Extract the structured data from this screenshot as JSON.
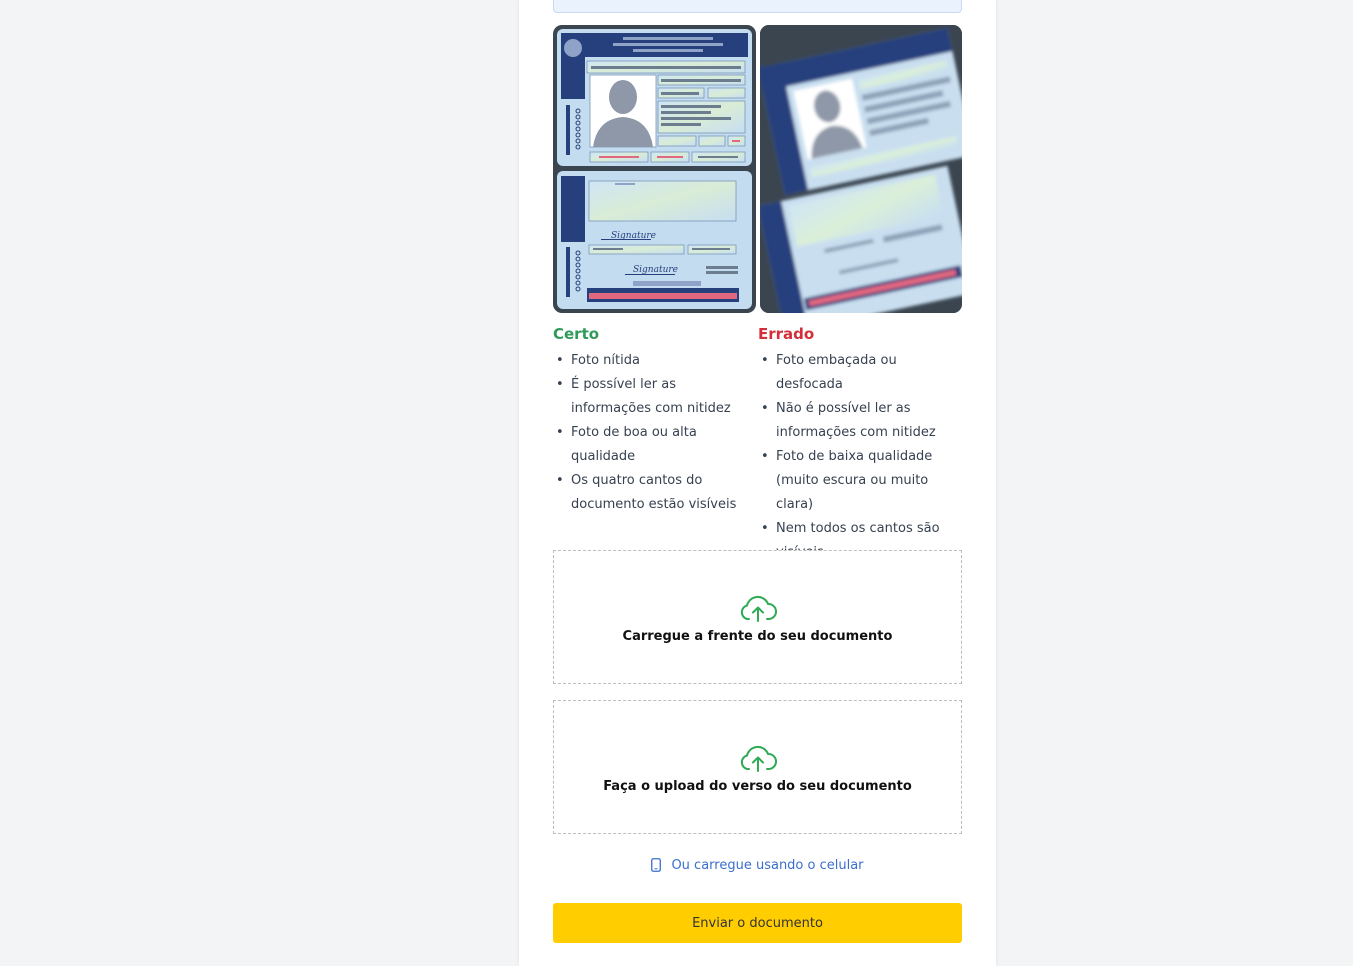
{
  "good": {
    "title": "Certo",
    "items": [
      "Foto nítida",
      "É possível ler as informações com nitidez",
      "Foto de boa ou alta qualidade",
      "Os quatro cantos do documento estão visíveis"
    ]
  },
  "bad": {
    "title": "Errado",
    "items": [
      "Foto embaçada ou desfocada",
      "Não é possível ler as informações com nitidez",
      "Foto de baixa qualidade (muito escura ou muito clara)",
      "Nem todos os cantos são visíveis"
    ]
  },
  "upload": {
    "front_label": "Carregue a frente do seu documento",
    "back_label": "Faça o upload do verso do seu documento",
    "mobile_link": "Ou carregue usando o celular"
  },
  "submit": {
    "label": "Enviar o documento"
  },
  "example_signature": "Signature",
  "colors": {
    "good": "#2f9a5a",
    "bad": "#d22f3a",
    "link": "#3a6fcf",
    "submit": "#ffcd00",
    "upload_icon": "#2faa55"
  },
  "icons": {
    "upload": "cloud-upload-icon",
    "mobile": "phone-icon"
  }
}
